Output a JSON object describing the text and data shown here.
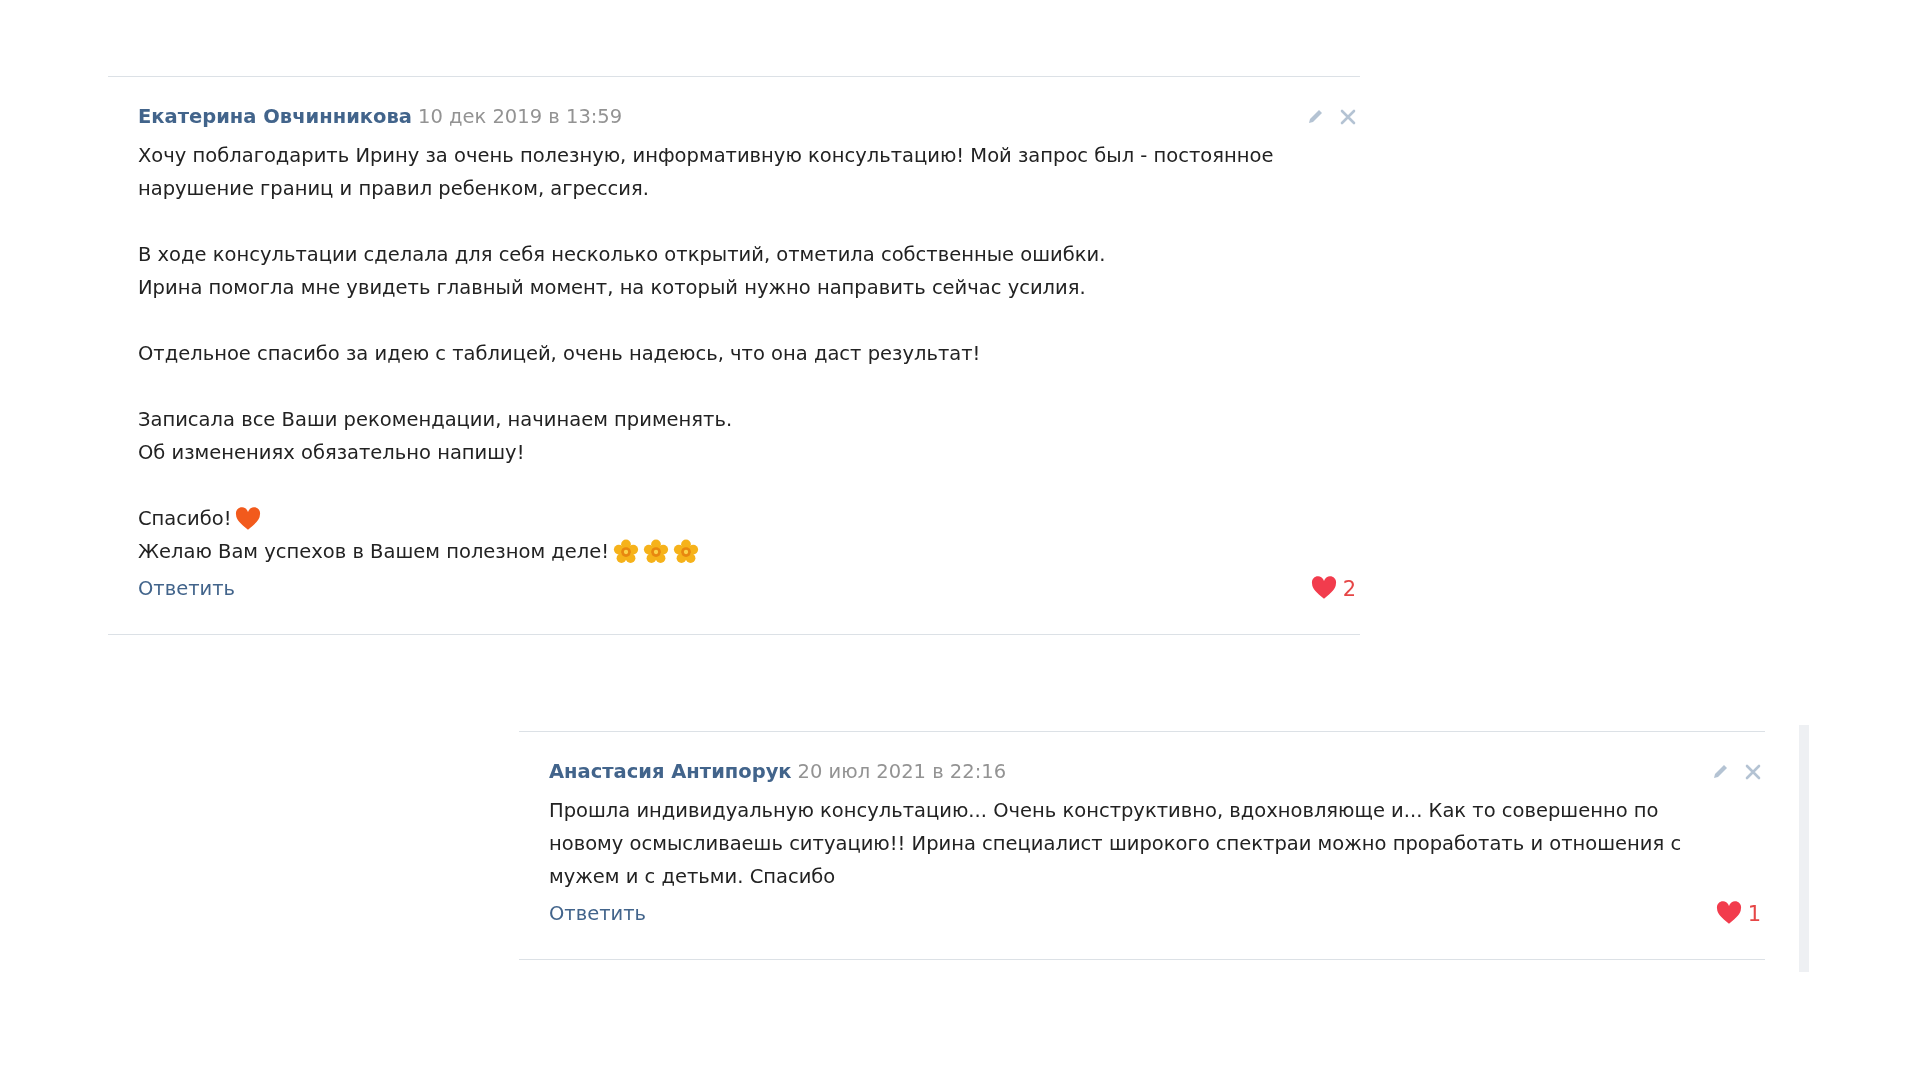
{
  "comments": [
    {
      "author": "Екатерина Овчинникова",
      "date": "10 дек 2019 в 13:59",
      "paragraphs": [
        {
          "lines": [
            {
              "text": "Хочу поблагодарить Ирину за очень полезную, информативную консультацию! Мой запрос был - постоянное"
            },
            {
              "text": "нарушение границ и правил ребенком, агрессия."
            }
          ]
        },
        {
          "lines": [
            {
              "text": "В ходе консультации сделала для себя несколько открытий, отметила собственные ошибки."
            },
            {
              "text": "Ирина помогла мне увидеть главный момент, на который нужно направить сейчас усилия."
            }
          ]
        },
        {
          "lines": [
            {
              "text": "Отдельное спасибо за идею с таблицей, очень надеюсь, что она даст результат!"
            }
          ]
        },
        {
          "lines": [
            {
              "text": "Записала все Ваши рекомендации, начинаем применять."
            },
            {
              "text": "Об изменениях обязательно напишу!"
            }
          ]
        },
        {
          "lines": [
            {
              "text": "Спасибо! ",
              "emojis": [
                {
                  "kind": "heart"
                }
              ]
            },
            {
              "text": "Желаю Вам успехов в Вашем полезном деле!",
              "emojis": [
                {
                  "kind": "flower"
                },
                {
                  "kind": "flower"
                },
                {
                  "kind": "flower"
                }
              ]
            }
          ]
        }
      ],
      "reply": "Ответить",
      "likes": {
        "count": "2",
        "liked": true
      }
    },
    {
      "author": "Анастасия Антипорук",
      "date": "20 июл 2021 в 22:16",
      "paragraphs": [
        {
          "lines": [
            {
              "text": "Прошла индивидуальную консультацию... Очень конструктивно, вдохновляюще и... Как то совершенно по"
            },
            {
              "text": "новому осмысливаешь ситуацию!! Ирина специалист широкого спектраи можно проработать и отношения с"
            },
            {
              "text": "мужем и с детьми. Спасибо"
            }
          ]
        }
      ],
      "reply": "Ответить",
      "likes": {
        "count": "1",
        "liked": true
      }
    }
  ]
}
